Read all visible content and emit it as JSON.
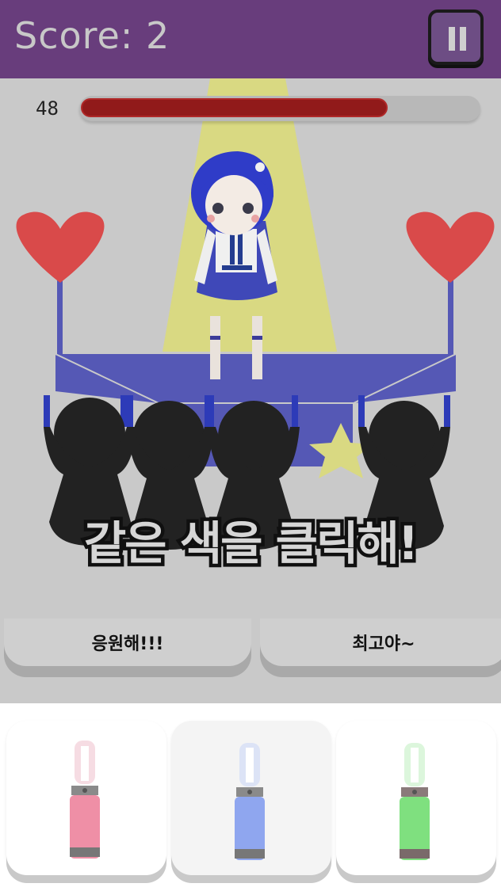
{
  "header": {
    "score_text": "Score: 2",
    "pause_icon": "pause-icon"
  },
  "timer": {
    "value": "48",
    "fill_fraction": 0.77
  },
  "colors": {
    "header_bg": "#683d7c",
    "timer_fill": "#911a1a",
    "heart": "#d94a4a",
    "stage": "#5558b5"
  },
  "instruction": "같은 색을 클릭해!",
  "options": [
    {
      "label": "응원해!!!"
    },
    {
      "label": "최고야~"
    }
  ],
  "lightsticks": [
    {
      "color": "pink",
      "hex": "#ef8fa6",
      "selected": false
    },
    {
      "color": "blue",
      "hex": "#8fa6ef",
      "selected": true
    },
    {
      "color": "green",
      "hex": "#7fe07f",
      "selected": false
    }
  ]
}
